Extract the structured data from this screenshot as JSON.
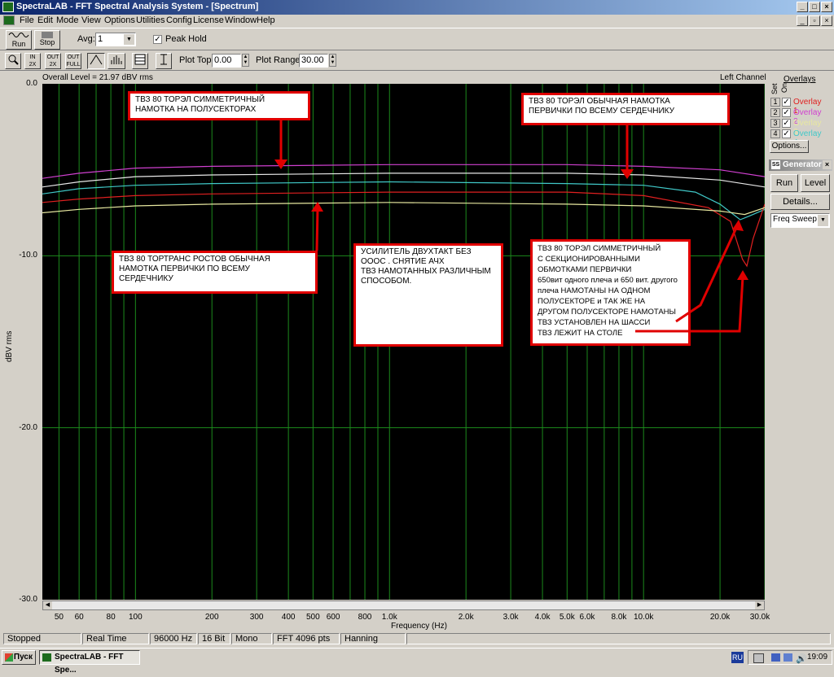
{
  "window": {
    "title": "SpectraLAB - FFT Spectral Analysis System - [Spectrum]",
    "controls": [
      "_",
      "□",
      "×"
    ]
  },
  "menu": [
    "File",
    "Edit",
    "Mode",
    "View",
    "Options",
    "Utilities",
    "Config",
    "License",
    "Window",
    "Help"
  ],
  "toolbar": {
    "run_label": "Run",
    "stop_label": "Stop",
    "avg_label": "Avg:",
    "avg_value": "1",
    "peak_hold_label": "Peak Hold",
    "plot_top_label": "Plot Top:",
    "plot_top_value": "0.00",
    "plot_range_label": "Plot Range:",
    "plot_range_value": "30.00"
  },
  "plot": {
    "overall_level": "Overall Level = 21.97 dBV rms",
    "channel": "Left Channel",
    "ylabel": "dBV rms",
    "xlabel": "Frequency (Hz)",
    "yticks": [
      "0.0",
      "-10.0",
      "-20.0",
      "-30.0"
    ],
    "xticks": [
      "50",
      "60",
      "80",
      "100",
      "200",
      "300",
      "400",
      "500",
      "600",
      "800",
      "1.0k",
      "2.0k",
      "3.0k",
      "4.0k",
      "5.0k",
      "6.0k",
      "8.0k",
      "10.0k",
      "20.0k",
      "30.0k"
    ]
  },
  "chart_data": {
    "type": "line",
    "xscale": "log",
    "xlim": [
      43,
      30000
    ],
    "ylim": [
      -30,
      0
    ],
    "grid": true,
    "series": [
      {
        "color": "#d040d0",
        "points": [
          [
            43,
            -5.5
          ],
          [
            60,
            -5.2
          ],
          [
            100,
            -4.9
          ],
          [
            200,
            -4.8
          ],
          [
            1000,
            -4.7
          ],
          [
            5000,
            -4.7
          ],
          [
            10000,
            -4.8
          ],
          [
            20000,
            -5.0
          ],
          [
            30000,
            -5.4
          ]
        ]
      },
      {
        "color": "#e8e8e8",
        "points": [
          [
            43,
            -6.0
          ],
          [
            60,
            -5.7
          ],
          [
            100,
            -5.4
          ],
          [
            200,
            -5.3
          ],
          [
            1000,
            -5.2
          ],
          [
            5000,
            -5.2
          ],
          [
            10000,
            -5.3
          ],
          [
            20000,
            -5.6
          ],
          [
            30000,
            -6.0
          ]
        ]
      },
      {
        "color": "#40c8c8",
        "points": [
          [
            43,
            -6.4
          ],
          [
            60,
            -6.1
          ],
          [
            100,
            -5.9
          ],
          [
            200,
            -5.8
          ],
          [
            1000,
            -5.7
          ],
          [
            5000,
            -5.8
          ],
          [
            10000,
            -5.9
          ],
          [
            16000,
            -6.3
          ],
          [
            20000,
            -7.0
          ],
          [
            24000,
            -7.9
          ],
          [
            26000,
            -7.7
          ],
          [
            30000,
            -7.3
          ]
        ]
      },
      {
        "color": "#e02020",
        "points": [
          [
            43,
            -6.9
          ],
          [
            60,
            -6.7
          ],
          [
            100,
            -6.5
          ],
          [
            200,
            -6.4
          ],
          [
            1000,
            -6.3
          ],
          [
            5000,
            -6.3
          ],
          [
            10000,
            -6.5
          ],
          [
            18000,
            -7.2
          ],
          [
            22000,
            -8.0
          ],
          [
            24500,
            -10.2
          ],
          [
            25500,
            -10.6
          ],
          [
            27000,
            -9.0
          ],
          [
            30000,
            -7.0
          ]
        ]
      },
      {
        "color": "#e8e8a0",
        "points": [
          [
            43,
            -7.5
          ],
          [
            60,
            -7.3
          ],
          [
            100,
            -7.1
          ],
          [
            200,
            -7.0
          ],
          [
            1000,
            -6.9
          ],
          [
            5000,
            -7.0
          ],
          [
            10000,
            -7.1
          ],
          [
            20000,
            -7.4
          ],
          [
            25000,
            -7.6
          ],
          [
            30000,
            -7.2
          ]
        ]
      }
    ]
  },
  "notes": [
    {
      "lines": [
        "ТВЗ 80  ТОРЭЛ  СИММЕТРИЧНЫЙ",
        "НАМОТКА  НА  ПОЛУСЕКТОРАХ"
      ]
    },
    {
      "lines": [
        "ТВЗ 80  ТОРЭЛ  ОБЫЧНАЯ  НАМОТКА",
        "ПЕРВИЧКИ ПО ВСЕМУ  СЕРДЕЧНИКУ"
      ]
    },
    {
      "lines": [
        "ТВЗ 80   ТОРТРАНС  РОСТОВ  ОБЫЧНАЯ",
        "НАМОТКА  ПЕРВИЧКИ  ПО ВСЕМУ",
        "СЕРДЕЧНИКУ"
      ]
    },
    {
      "lines": [
        "УСИЛИТЕЛЬ  ДВУХТАКТ  БЕЗ",
        "ОООС  .  СНЯТИЕ  АЧХ",
        "ТВЗ  НАМОТАННЫХ  РАЗЛИЧНЫМ",
        "СПОСОБОМ."
      ]
    },
    {
      "lines": [
        "ТВЗ 80  ТОРЭЛ  СИММЕТРИЧНЫЙ",
        "С  СЕКЦИОНИРОВАННЫМИ",
        "ОБМОТКАМИ ПЕРВИЧКИ",
        "650вит одного плеча и 650 вит. другого",
        "плеча НАМОТАНЫ  НА  ОДНОМ",
        "ПОЛУСЕКТОРЕ и ТАК  ЖЕ  НА",
        "ДРУГОМ ПОЛУСЕКТОРЕ НАМОТАНЫ",
        "ТВЗ   УСТАНОВЛЕН  НА  ШАССИ",
        "ТВЗ  ЛЕЖИТ НА  СТОЛЕ"
      ]
    }
  ],
  "overlays": {
    "title": "Overlays",
    "set_label": "Set",
    "on_label": "On",
    "items": [
      {
        "num": "1",
        "label": "Overlay 1",
        "color": "#e02020"
      },
      {
        "num": "2",
        "label": "Overlay 2",
        "color": "#d040d0"
      },
      {
        "num": "3",
        "label": "Overlay 3",
        "color": "#e8e8a0"
      },
      {
        "num": "4",
        "label": "Overlay 4",
        "color": "#40c8c8"
      }
    ],
    "options_label": "Options..."
  },
  "generator": {
    "title": "Generator",
    "run_label": "Run",
    "level_label": "Level",
    "details_label": "Details...",
    "mode_value": "Freq Sweep"
  },
  "status": [
    "Stopped",
    "Real Time",
    "96000 Hz",
    "16 Bit",
    "Mono",
    "FFT 4096 pts",
    "Hanning"
  ],
  "taskbar": {
    "start_label": "Пуск",
    "task_label": "SpectraLAB - FFT Spe...",
    "lang": "RU",
    "clock": "19:09"
  }
}
